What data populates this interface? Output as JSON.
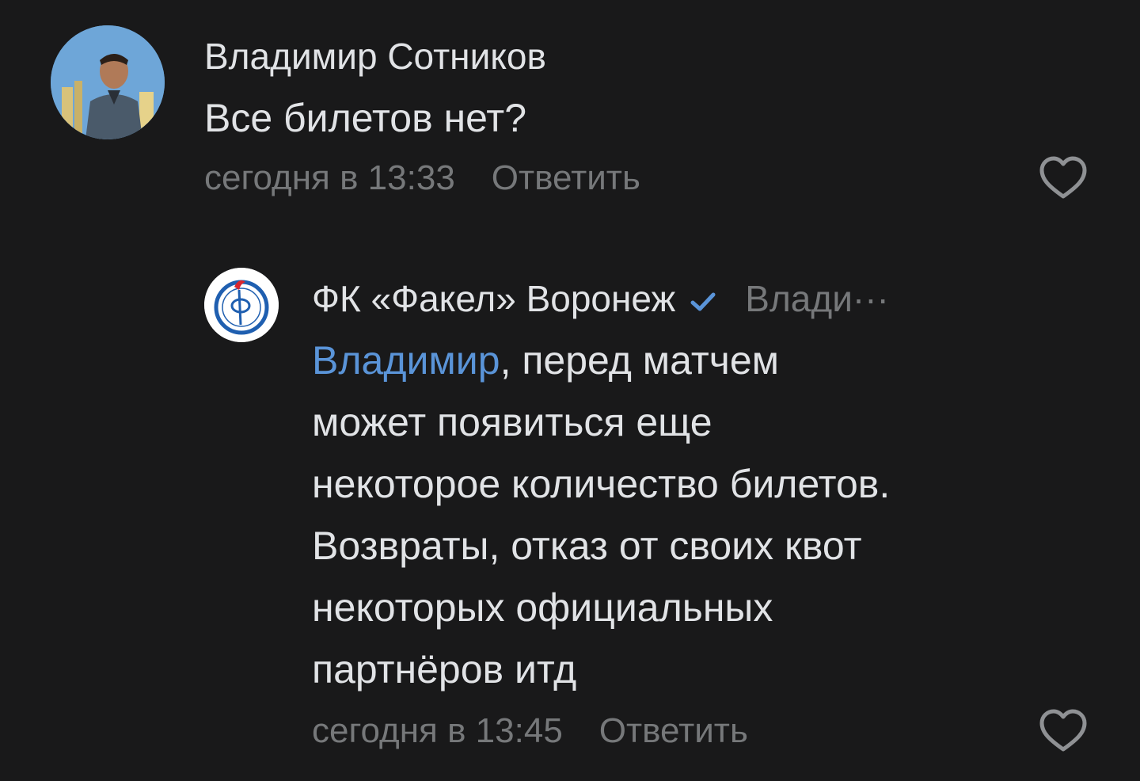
{
  "comment": {
    "author": "Владимир Сотников",
    "text": "Все билетов нет?",
    "time": "сегодня в 13:33",
    "reply_label": "Ответить",
    "avatar_icon": "user-photo-avatar",
    "like_icon": "heart-outline-icon"
  },
  "reply": {
    "author": "ФК «Факел» Воронеж",
    "verified_icon": "verified-check-icon",
    "reply_to": "Влади···",
    "mention": "Владимир",
    "text_line1_rest": ", перед матчем",
    "text_lines": [
      "может появиться еще",
      "некоторое количество билетов.",
      "Возвраты, отказ от своих квот",
      "некоторых официальных",
      "партнёров итд"
    ],
    "time": "сегодня в 13:45",
    "reply_label": "Ответить",
    "avatar_icon": "club-logo-avatar",
    "like_icon": "heart-outline-icon"
  },
  "colors": {
    "background": "#19191a",
    "text_primary": "#e1e3e6",
    "text_secondary": "#76787a",
    "accent": "#5a94d8"
  }
}
